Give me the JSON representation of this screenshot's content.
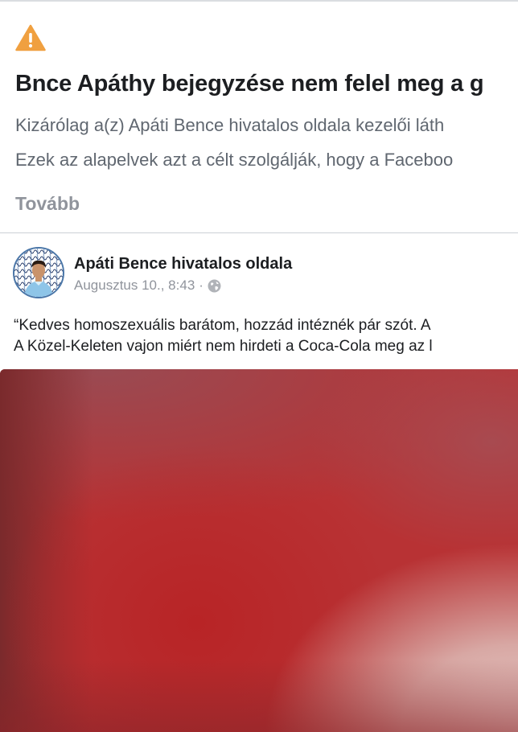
{
  "notice": {
    "icon": "warning-triangle-icon",
    "icon_color": "#f0a040",
    "title": "Bnce Apáthy bejegyzése nem felel meg a g",
    "line1": "Kizárólag a(z) Apáti Bence hivatalos oldala kezelői láth",
    "line2": "Ezek az alapelvek azt a célt szolgálják, hogy a Faceboo",
    "more_label": "Tovább"
  },
  "post": {
    "page_name": "Apáti Bence hivatalos oldala",
    "timestamp": "Augusztus 10., 8:43",
    "separator": "·",
    "audience_icon": "globe-icon",
    "text_lines": [
      "“Kedves homoszexuális barátom, hozzád intéznék pár szót. A",
      "A Közel-Keleten vajon miért nem hirdeti a Coca-Cola meg az l"
    ],
    "image_dominant_color": "#b83234"
  }
}
